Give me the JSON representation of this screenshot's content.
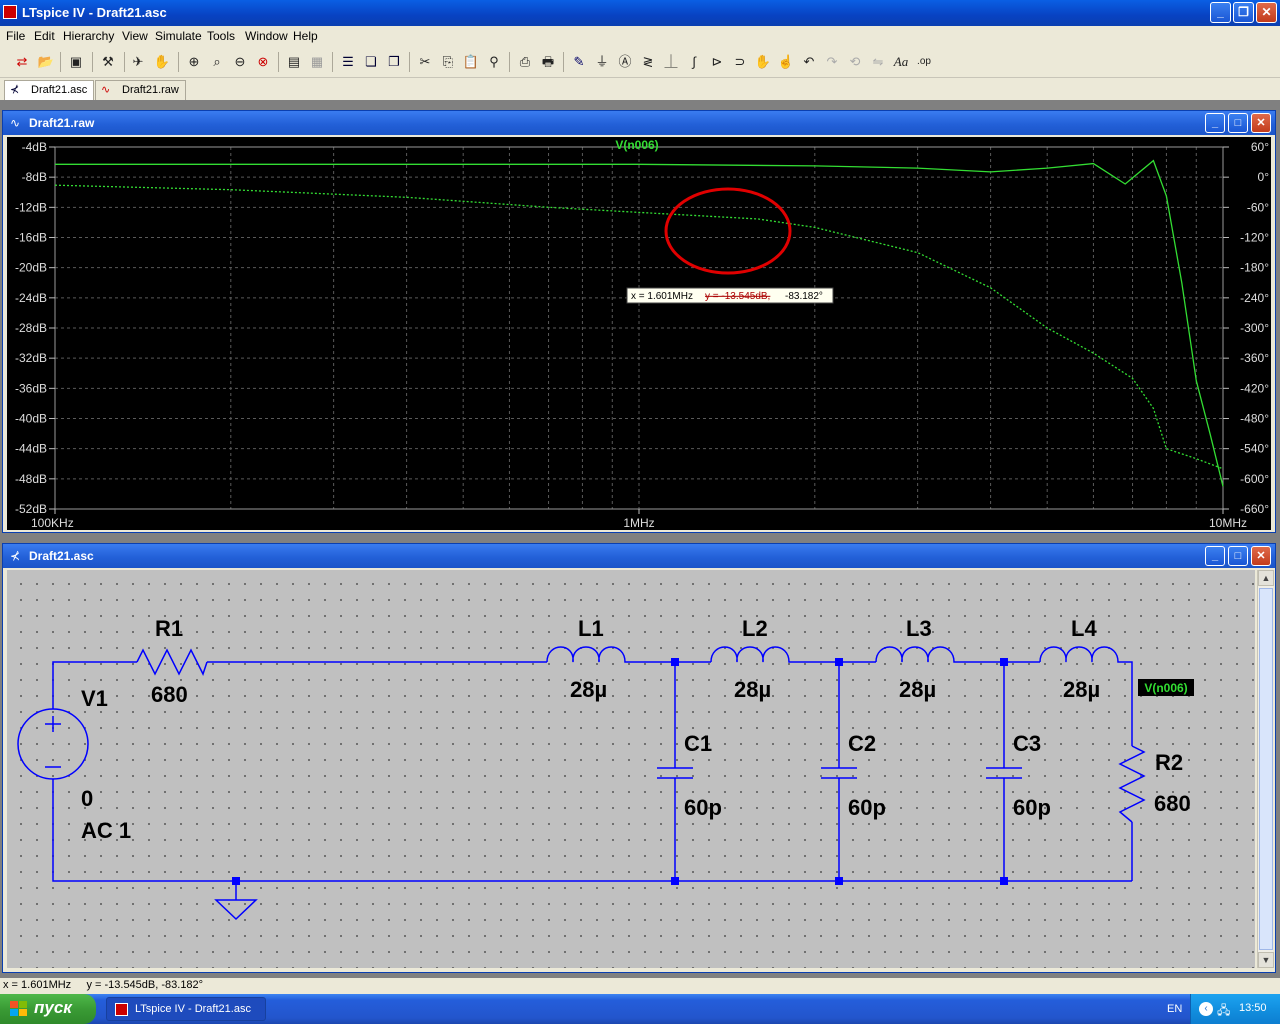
{
  "app": {
    "title": "LTspice IV - Draft21.asc"
  },
  "menu": [
    "File",
    "Edit",
    "Hierarchy",
    "View",
    "Simulate",
    "Tools",
    "Window",
    "Help"
  ],
  "toolbar_icons": [
    "run-icon",
    "open-icon",
    "save-icon",
    "control-panel-icon",
    "run-simulation-icon",
    "halt-icon",
    "zoom-in-icon",
    "zoom-area-icon",
    "zoom-out-icon",
    "zoom-cancel-icon",
    "autorange-icon",
    "grid-icon",
    "tile-horizontal-icon",
    "cascade-icon",
    "tile-icon",
    "cut-icon",
    "copy-icon",
    "paste-icon",
    "find-icon",
    "print-preview-icon",
    "print-icon",
    "wire-icon",
    "ground-icon",
    "label-icon",
    "resistor-icon",
    "capacitor-icon",
    "inductor-icon",
    "diode-icon",
    "component-icon",
    "move-icon",
    "drag-icon",
    "undo-icon",
    "redo-icon",
    "rotate-icon",
    "mirror-icon",
    "text-icon",
    "spice-directive-icon"
  ],
  "tabs": [
    {
      "label": "Draft21.asc",
      "icon": "schematic-icon",
      "active": true
    },
    {
      "label": "Draft21.raw",
      "icon": "waveform-icon",
      "active": false
    }
  ],
  "plot_window": {
    "title": "Draft21.raw",
    "trace_label": "V(n006)",
    "cursor_readout": {
      "x_text": "x = 1.601MHz",
      "y_text": "y = -13.545dB,",
      "phase_text": "-83.182°"
    }
  },
  "chart_data": {
    "type": "line",
    "title": "V(n006)",
    "x_scale": "log",
    "xlim": [
      100000,
      10000000
    ],
    "x_tick_labels": [
      "100KHz",
      "1MHz",
      "10MHz"
    ],
    "y_left_ticks": [
      "-4dB",
      "-8dB",
      "-12dB",
      "-16dB",
      "-20dB",
      "-24dB",
      "-28dB",
      "-32dB",
      "-36dB",
      "-40dB",
      "-44dB",
      "-48dB",
      "-52dB"
    ],
    "ylim_left": [
      -52,
      -4
    ],
    "y_right_ticks": [
      "60°",
      "0°",
      "-60°",
      "-120°",
      "-180°",
      "-240°",
      "-300°",
      "-360°",
      "-420°",
      "-480°",
      "-540°",
      "-600°",
      "-660°"
    ],
    "ylim_right": [
      -660,
      60
    ],
    "grid": true,
    "series": [
      {
        "name": "V(n006)",
        "axis": "left",
        "style": "solid",
        "color": "#33dd33",
        "x": [
          100000,
          300000,
          1000000,
          2000000,
          3000000,
          4000000,
          5000000,
          6000000,
          6800000,
          7600000,
          8000000,
          8500000,
          9000000,
          9500000,
          10000000
        ],
        "y": [
          -6.3,
          -6.3,
          -6.3,
          -6.5,
          -6.8,
          -7.3,
          -6.8,
          -6.2,
          -8.9,
          -5.8,
          -10.5,
          -22.0,
          -35.0,
          -42.0,
          -49.0
        ]
      },
      {
        "name": "phase",
        "axis": "right",
        "style": "dashed",
        "color": "#33dd33",
        "x": [
          100000,
          200000,
          400000,
          700000,
          1000000,
          1601000,
          2000000,
          3000000,
          4000000,
          5000000,
          6000000,
          7000000,
          7600000,
          8000000,
          9000000,
          10000000
        ],
        "y": [
          -16,
          -25,
          -40,
          -60,
          -70,
          -83.182,
          -100,
          -150,
          -220,
          -300,
          -350,
          -400,
          -460,
          -540,
          -560,
          -580
        ]
      }
    ],
    "annotation": "cursor at x = 1.601MHz, y = -13.545dB, -83.182°"
  },
  "schematic_window": {
    "title": "Draft21.asc",
    "components": {
      "V1": {
        "name": "V1",
        "value": "0",
        "extra": "AC 1"
      },
      "R1": {
        "name": "R1",
        "value": "680"
      },
      "R2": {
        "name": "R2",
        "value": "680"
      },
      "L1": {
        "name": "L1",
        "value": "28µ"
      },
      "L2": {
        "name": "L2",
        "value": "28µ"
      },
      "L3": {
        "name": "L3",
        "value": "28µ"
      },
      "L4": {
        "name": "L4",
        "value": "28µ"
      },
      "C1": {
        "name": "C1",
        "value": "60p"
      },
      "C2": {
        "name": "C2",
        "value": "60p"
      },
      "C3": {
        "name": "C3",
        "value": "60p"
      }
    },
    "net_label": "V(n006)"
  },
  "status": {
    "text": "x = 1.601MHz     y = -13.545dB, -83.182°"
  },
  "taskbar": {
    "start_label": "пуск",
    "task_item": "LTspice IV - Draft21.asc",
    "lang": "EN",
    "clock": "13:50"
  },
  "colors": {
    "trace": "#33dd33",
    "grid": "#5a5a5a",
    "wire": "#0000ff",
    "highlight_circle": "#e00000",
    "xp_blue": "#0a5fe4"
  }
}
